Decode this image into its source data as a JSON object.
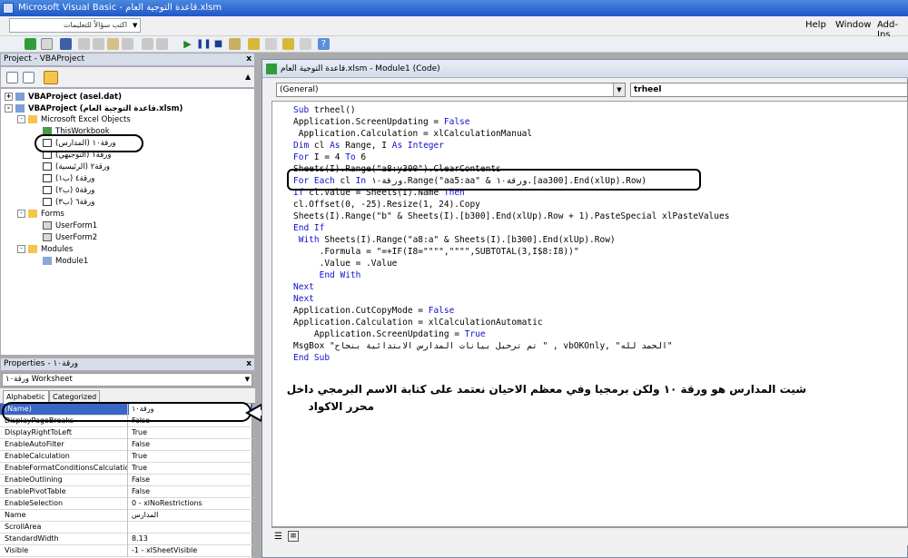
{
  "window": {
    "title": "Microsoft Visual Basic - قاعدة التوجية العام.xlsm"
  },
  "menubar": {
    "help_search_placeholder": "اكتب سؤالاً للتعليمات",
    "items": [
      "Help",
      "Window",
      "Add-Ins"
    ]
  },
  "project_pane": {
    "title": "Project - VBAProject",
    "close": "x",
    "tree": [
      {
        "toggle": "+",
        "label": "VBAProject (asel.dat)",
        "bold": true
      },
      {
        "toggle": "-",
        "label": "VBAProject (قاعدة التوجية العام.xlsm)",
        "bold": true
      },
      {
        "toggle": "-",
        "label": "Microsoft Excel Objects"
      },
      {
        "label": "ThisWorkbook"
      },
      {
        "label": "ورقة١٠ (المدارس)"
      },
      {
        "label": "ورقة١ (التوجيهي)"
      },
      {
        "label": "ورقة٢ (الرئيسية)"
      },
      {
        "label": "ورقة٤ (ب١)"
      },
      {
        "label": "ورقة٥ (ب٢)"
      },
      {
        "label": "ورقة٦ (ب٣)"
      },
      {
        "toggle": "-",
        "label": "Forms"
      },
      {
        "label": "UserForm1"
      },
      {
        "label": "UserForm2"
      },
      {
        "toggle": "-",
        "label": "Modules"
      },
      {
        "label": "Module1"
      }
    ]
  },
  "properties_pane": {
    "title": "Properties - ورقة١٠",
    "close": "x",
    "object_combo": "ورقة١٠ Worksheet",
    "tabs": [
      "Alphabetic",
      "Categorized"
    ],
    "rows": [
      {
        "name": "(Name)",
        "value": "ورقة١٠"
      },
      {
        "name": "DisplayPageBreaks",
        "value": "False"
      },
      {
        "name": "DisplayRightToLeft",
        "value": "True"
      },
      {
        "name": "EnableAutoFilter",
        "value": "False"
      },
      {
        "name": "EnableCalculation",
        "value": "True"
      },
      {
        "name": "EnableFormatConditionsCalculation",
        "value": "True"
      },
      {
        "name": "EnableOutlining",
        "value": "False"
      },
      {
        "name": "EnablePivotTable",
        "value": "False"
      },
      {
        "name": "EnableSelection",
        "value": "0 - xlNoRestrictions"
      },
      {
        "name": "Name",
        "value": "المدارس"
      },
      {
        "name": "ScrollArea",
        "value": ""
      },
      {
        "name": "StandardWidth",
        "value": "8.13"
      },
      {
        "name": "Visible",
        "value": "-1 - xlSheetVisible"
      }
    ]
  },
  "code_window": {
    "title": "قاعدة التوجية العام.xlsm - Module1 (Code)",
    "object_combo": "(General)",
    "proc_combo": "trheel",
    "lines": [
      [
        {
          "t": "Sub",
          "k": true
        },
        {
          "t": " trheel()"
        }
      ],
      [
        {
          "t": "Application.ScreenUpdating = "
        },
        {
          "t": "False",
          "k": true
        }
      ],
      [
        {
          "t": " Application.Calculation = xlCalculationManual"
        }
      ],
      [
        {
          "t": "Dim",
          "k": true
        },
        {
          "t": " cl "
        },
        {
          "t": "As",
          "k": true
        },
        {
          "t": " Range, I "
        },
        {
          "t": "As",
          "k": true
        },
        {
          "t": " "
        },
        {
          "t": "Integer",
          "k": true
        }
      ],
      [
        {
          "t": "For",
          "k": true
        },
        {
          "t": " I = 4 "
        },
        {
          "t": "To",
          "k": true
        },
        {
          "t": " 6"
        }
      ],
      [
        {
          "t": "Sheets(I).Range(\"a8:y300\").ClearContents"
        }
      ],
      [
        {
          "t": "For Each",
          "k": true
        },
        {
          "t": " cl "
        },
        {
          "t": "In",
          "k": true
        },
        {
          "t": " ورقة١٠.Range(\"aa5:aa\" & ورقة١٠.[aa300].End(xlUp).Row)"
        }
      ],
      [
        {
          "t": "If",
          "k": true
        },
        {
          "t": " cl.Value = Sheets(I).Name "
        },
        {
          "t": "Then",
          "k": true
        }
      ],
      [
        {
          "t": "cl.Offset(0, -25).Resize(1, 24).Copy"
        }
      ],
      [
        {
          "t": "Sheets(I).Range(\"b\" & Sheets(I).[b300].End(xlUp).Row + 1).PasteSpecial xlPasteValues"
        }
      ],
      [
        {
          "t": "End If",
          "k": true
        }
      ],
      [
        {
          "t": " "
        },
        {
          "t": "With",
          "k": true
        },
        {
          "t": " Sheets(I).Range(\"a8:a\" & Sheets(I).[b300].End(xlUp).Row)"
        }
      ],
      [
        {
          "t": "     .Formula = \"=+IF(I8=\"\"\"\",\"\"\"\",SUBTOTAL(3,I$8:I8))\""
        }
      ],
      [
        {
          "t": "     .Value = .Value"
        }
      ],
      [
        {
          "t": "     "
        },
        {
          "t": "End With",
          "k": true
        }
      ],
      [
        {
          "t": "Next",
          "k": true
        }
      ],
      [
        {
          "t": "Next",
          "k": true
        }
      ],
      [
        {
          "t": "Application.CutCopyMode = "
        },
        {
          "t": "False",
          "k": true
        }
      ],
      [
        {
          "t": "Application.Calculation = xlCalculationAutomatic"
        }
      ],
      [
        {
          "t": "    Application.ScreenUpdating = "
        },
        {
          "t": "True",
          "k": true
        }
      ],
      [
        {
          "t": "MsgBox \"تم ترحيل بيانات المدارس الابتدائية بنجاح \" , vbOKOnly, \"الحمد لله\""
        }
      ],
      [
        {
          "t": "End Sub",
          "k": true
        }
      ]
    ]
  },
  "annotation": {
    "line1": "شيت المدارس هو ورقة ١٠ ولكن برمجيا وفي معظم الاحيان نعتمد على كتابة الاسم البرمجي  داخل",
    "line2": "محرر الاكواد"
  }
}
